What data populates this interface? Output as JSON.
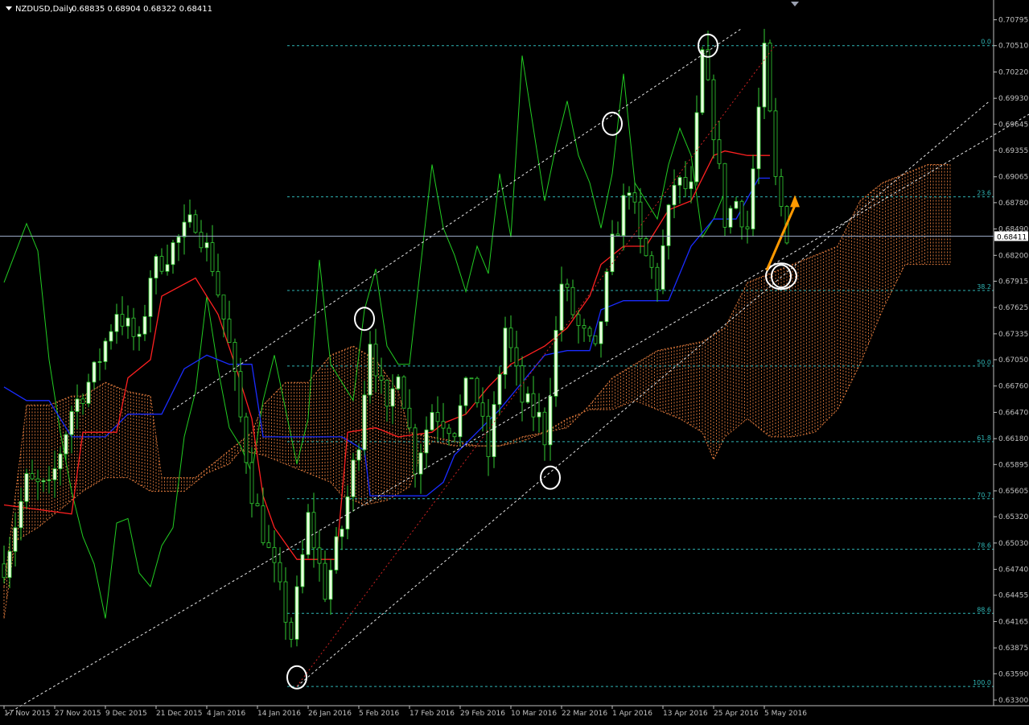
{
  "header": {
    "symbol": "NZDUSD,Daily",
    "ohlc": "0.68835 0.68904 0.68322 0.68411"
  },
  "colors": {
    "background": "#000000",
    "axis": "#c0c0c0",
    "candle_up": "#eaffe0",
    "candle_down": "#000000",
    "candle_wick": "#33cc33",
    "tenkan": "#ff2020",
    "kijun": "#1a2cff",
    "chikou": "#22cc22",
    "cloud": "#e07a3c",
    "fib": "#2fb5b5",
    "channel": "#e8e8e8",
    "trend_red": "#cc2222",
    "arrow": "#ff9900",
    "circle": "#ffffff"
  },
  "chart_data": {
    "type": "candlestick",
    "title": "NZDUSD,Daily",
    "ylim": [
      0.633,
      0.7088
    ],
    "y_ticks": [
      "0.70795",
      "0.70510",
      "0.70220",
      "0.69930",
      "0.69645",
      "0.69355",
      "0.69065",
      "0.68780",
      "0.68490",
      "0.68200",
      "0.67915",
      "0.67625",
      "0.67335",
      "0.67050",
      "0.66760",
      "0.66470",
      "0.66180",
      "0.65895",
      "0.65605",
      "0.65320",
      "0.65030",
      "0.64740",
      "0.64455",
      "0.64165",
      "0.63875",
      "0.63590",
      "0.63300"
    ],
    "x_tick_labels": [
      "17 Nov 2015",
      "27 Nov 2015",
      "9 Dec 2015",
      "21 Dec 2015",
      "4 Jan 2016",
      "14 Jan 2016",
      "26 Jan 2016",
      "5 Feb 2016",
      "17 Feb 2016",
      "29 Feb 2016",
      "10 Mar 2016",
      "22 Mar 2016",
      "1 Apr 2016",
      "13 Apr 2016",
      "25 Apr 2016",
      "5 May 2016"
    ],
    "current_price": "0.68411",
    "fibonacci": {
      "high": 0.7051,
      "low": 0.6345,
      "levels": [
        {
          "label": "0.0",
          "ratio": 0
        },
        {
          "label": "23.6",
          "ratio": 0.236
        },
        {
          "label": "38.2",
          "ratio": 0.382
        },
        {
          "label": "50.0",
          "ratio": 0.5
        },
        {
          "label": "61.8",
          "ratio": 0.618
        },
        {
          "label": "70.7",
          "ratio": 0.707
        },
        {
          "label": "78.6",
          "ratio": 0.786
        },
        {
          "label": "88.6",
          "ratio": 0.886
        },
        {
          "label": "100.0",
          "ratio": 1.0
        }
      ]
    },
    "tenkan_points": [
      [
        0,
        0.6545
      ],
      [
        12,
        0.6535
      ],
      [
        14,
        0.6625
      ],
      [
        20,
        0.6625
      ],
      [
        22,
        0.6685
      ],
      [
        26,
        0.6705
      ],
      [
        28,
        0.6775
      ],
      [
        34,
        0.6795
      ],
      [
        38,
        0.6755
      ],
      [
        41,
        0.67
      ],
      [
        44,
        0.664
      ],
      [
        46,
        0.6555
      ],
      [
        48,
        0.652
      ],
      [
        52,
        0.6485
      ],
      [
        59,
        0.6485
      ],
      [
        61,
        0.6625
      ],
      [
        66,
        0.663
      ],
      [
        70,
        0.662
      ],
      [
        76,
        0.6625
      ],
      [
        78,
        0.6635
      ],
      [
        82,
        0.6645
      ],
      [
        86,
        0.6675
      ],
      [
        90,
        0.67
      ],
      [
        96,
        0.672
      ],
      [
        100,
        0.674
      ],
      [
        104,
        0.6775
      ],
      [
        106,
        0.681
      ],
      [
        110,
        0.683
      ],
      [
        114,
        0.683
      ],
      [
        118,
        0.687
      ],
      [
        122,
        0.688
      ],
      [
        126,
        0.693
      ],
      [
        128,
        0.6935
      ],
      [
        132,
        0.693
      ],
      [
        136,
        0.693
      ]
    ],
    "kijun_points": [
      [
        0,
        0.6675
      ],
      [
        4,
        0.666
      ],
      [
        8,
        0.666
      ],
      [
        12,
        0.662
      ],
      [
        18,
        0.662
      ],
      [
        22,
        0.6645
      ],
      [
        28,
        0.6645
      ],
      [
        32,
        0.6695
      ],
      [
        36,
        0.671
      ],
      [
        40,
        0.67
      ],
      [
        44,
        0.67
      ],
      [
        46,
        0.662
      ],
      [
        54,
        0.662
      ],
      [
        60,
        0.662
      ],
      [
        64,
        0.6605
      ],
      [
        65,
        0.6555
      ],
      [
        75,
        0.6555
      ],
      [
        78,
        0.657
      ],
      [
        80,
        0.66
      ],
      [
        84,
        0.6625
      ],
      [
        88,
        0.665
      ],
      [
        92,
        0.668
      ],
      [
        96,
        0.671
      ],
      [
        100,
        0.6715
      ],
      [
        104,
        0.6715
      ],
      [
        106,
        0.676
      ],
      [
        110,
        0.677
      ],
      [
        118,
        0.677
      ],
      [
        122,
        0.683
      ],
      [
        126,
        0.686
      ],
      [
        130,
        0.686
      ],
      [
        134,
        0.6905
      ],
      [
        136,
        0.6905
      ]
    ],
    "chikou_points": [
      [
        0,
        0.679
      ],
      [
        4,
        0.6855
      ],
      [
        6,
        0.6825
      ],
      [
        8,
        0.6705
      ],
      [
        10,
        0.6625
      ],
      [
        12,
        0.656
      ],
      [
        14,
        0.651
      ],
      [
        16,
        0.648
      ],
      [
        18,
        0.642
      ],
      [
        20,
        0.6525
      ],
      [
        22,
        0.653
      ],
      [
        24,
        0.647
      ],
      [
        26,
        0.6455
      ],
      [
        28,
        0.65
      ],
      [
        30,
        0.652
      ],
      [
        32,
        0.662
      ],
      [
        34,
        0.667
      ],
      [
        36,
        0.6775
      ],
      [
        38,
        0.6695
      ],
      [
        40,
        0.663
      ],
      [
        42,
        0.661
      ],
      [
        44,
        0.658
      ],
      [
        46,
        0.666
      ],
      [
        48,
        0.671
      ],
      [
        50,
        0.665
      ],
      [
        52,
        0.659
      ],
      [
        54,
        0.664
      ],
      [
        56,
        0.6815
      ],
      [
        58,
        0.67
      ],
      [
        60,
        0.668
      ],
      [
        62,
        0.666
      ],
      [
        64,
        0.676
      ],
      [
        66,
        0.6805
      ],
      [
        68,
        0.672
      ],
      [
        70,
        0.67
      ],
      [
        72,
        0.67
      ],
      [
        74,
        0.681
      ],
      [
        76,
        0.692
      ],
      [
        78,
        0.685
      ],
      [
        80,
        0.682
      ],
      [
        82,
        0.678
      ],
      [
        84,
        0.683
      ],
      [
        86,
        0.68
      ],
      [
        88,
        0.691
      ],
      [
        90,
        0.684
      ],
      [
        92,
        0.704
      ],
      [
        94,
        0.696
      ],
      [
        96,
        0.688
      ],
      [
        98,
        0.694
      ],
      [
        100,
        0.699
      ],
      [
        102,
        0.693
      ],
      [
        104,
        0.69
      ],
      [
        106,
        0.685
      ],
      [
        108,
        0.691
      ],
      [
        110,
        0.702
      ],
      [
        112,
        0.69
      ],
      [
        114,
        0.688
      ],
      [
        116,
        0.686
      ],
      [
        118,
        0.692
      ],
      [
        120,
        0.696
      ],
      [
        122,
        0.693
      ],
      [
        124,
        0.684
      ],
      [
        126,
        0.686
      ],
      [
        128,
        0.689
      ]
    ],
    "cloud_top": [
      [
        0,
        0.6455
      ],
      [
        4,
        0.6655
      ],
      [
        8,
        0.6655
      ],
      [
        12,
        0.6665
      ],
      [
        14,
        0.6665
      ],
      [
        18,
        0.668
      ],
      [
        22,
        0.667
      ],
      [
        26,
        0.6665
      ],
      [
        28,
        0.6575
      ],
      [
        34,
        0.6575
      ],
      [
        36,
        0.6585
      ],
      [
        40,
        0.6605
      ],
      [
        44,
        0.6625
      ],
      [
        46,
        0.6655
      ],
      [
        50,
        0.668
      ],
      [
        54,
        0.668
      ],
      [
        58,
        0.671
      ],
      [
        62,
        0.672
      ],
      [
        66,
        0.6705
      ],
      [
        70,
        0.667
      ],
      [
        72,
        0.6625
      ],
      [
        76,
        0.662
      ],
      [
        80,
        0.6615
      ],
      [
        84,
        0.661
      ],
      [
        88,
        0.661
      ],
      [
        92,
        0.6615
      ],
      [
        96,
        0.6625
      ],
      [
        100,
        0.663
      ],
      [
        104,
        0.6655
      ],
      [
        108,
        0.6685
      ],
      [
        112,
        0.67
      ],
      [
        116,
        0.6715
      ],
      [
        120,
        0.672
      ],
      [
        124,
        0.6725
      ],
      [
        128,
        0.674
      ],
      [
        132,
        0.679
      ],
      [
        136,
        0.68
      ],
      [
        140,
        0.681
      ],
      [
        144,
        0.682
      ],
      [
        148,
        0.683
      ],
      [
        152,
        0.688
      ],
      [
        156,
        0.69
      ],
      [
        160,
        0.691
      ],
      [
        164,
        0.692
      ],
      [
        168,
        0.692
      ]
    ],
    "cloud_bottom": [
      [
        0,
        0.642
      ],
      [
        2,
        0.6505
      ],
      [
        6,
        0.652
      ],
      [
        14,
        0.656
      ],
      [
        18,
        0.6575
      ],
      [
        22,
        0.6575
      ],
      [
        26,
        0.656
      ],
      [
        30,
        0.656
      ],
      [
        32,
        0.656
      ],
      [
        36,
        0.658
      ],
      [
        40,
        0.659
      ],
      [
        42,
        0.6605
      ],
      [
        46,
        0.66
      ],
      [
        50,
        0.659
      ],
      [
        54,
        0.658
      ],
      [
        58,
        0.657
      ],
      [
        60,
        0.6555
      ],
      [
        64,
        0.6545
      ],
      [
        68,
        0.655
      ],
      [
        72,
        0.6565
      ],
      [
        74,
        0.66
      ],
      [
        76,
        0.6615
      ],
      [
        80,
        0.661
      ],
      [
        84,
        0.661
      ],
      [
        88,
        0.661
      ],
      [
        92,
        0.662
      ],
      [
        96,
        0.6625
      ],
      [
        100,
        0.664
      ],
      [
        104,
        0.665
      ],
      [
        108,
        0.665
      ],
      [
        112,
        0.666
      ],
      [
        116,
        0.665
      ],
      [
        120,
        0.664
      ],
      [
        124,
        0.6625
      ],
      [
        126,
        0.6595
      ],
      [
        128,
        0.662
      ],
      [
        132,
        0.664
      ],
      [
        136,
        0.662
      ],
      [
        140,
        0.662
      ],
      [
        144,
        0.6625
      ],
      [
        148,
        0.665
      ],
      [
        152,
        0.67
      ],
      [
        156,
        0.676
      ],
      [
        160,
        0.681
      ],
      [
        164,
        0.681
      ],
      [
        168,
        0.681
      ]
    ],
    "channel_upper": {
      "x1": 0.6,
      "y1": 0.6315,
      "x2": 208,
      "y2": 0.707
    },
    "channel_lower": {
      "x1": 52,
      "y1": 0.6345,
      "x2": 175,
      "y2": 0.699
    },
    "channel_mid": {
      "x1": 30,
      "y1": 0.665,
      "x2": 131,
      "y2": 0.707
    },
    "trend_red": {
      "x1": 52,
      "y1": 0.6345,
      "x2": 137,
      "y2": 0.7052
    },
    "arrow": {
      "x1": 135,
      "y1": 0.68,
      "x2": 140,
      "y2": 0.6882
    },
    "circles": [
      [
        52,
        0.6355
      ],
      [
        64,
        0.675
      ],
      [
        97,
        0.6575
      ],
      [
        108,
        0.6965
      ],
      [
        125,
        0.7051
      ],
      [
        138,
        0.6797
      ]
    ],
    "candle_count": 140
  }
}
